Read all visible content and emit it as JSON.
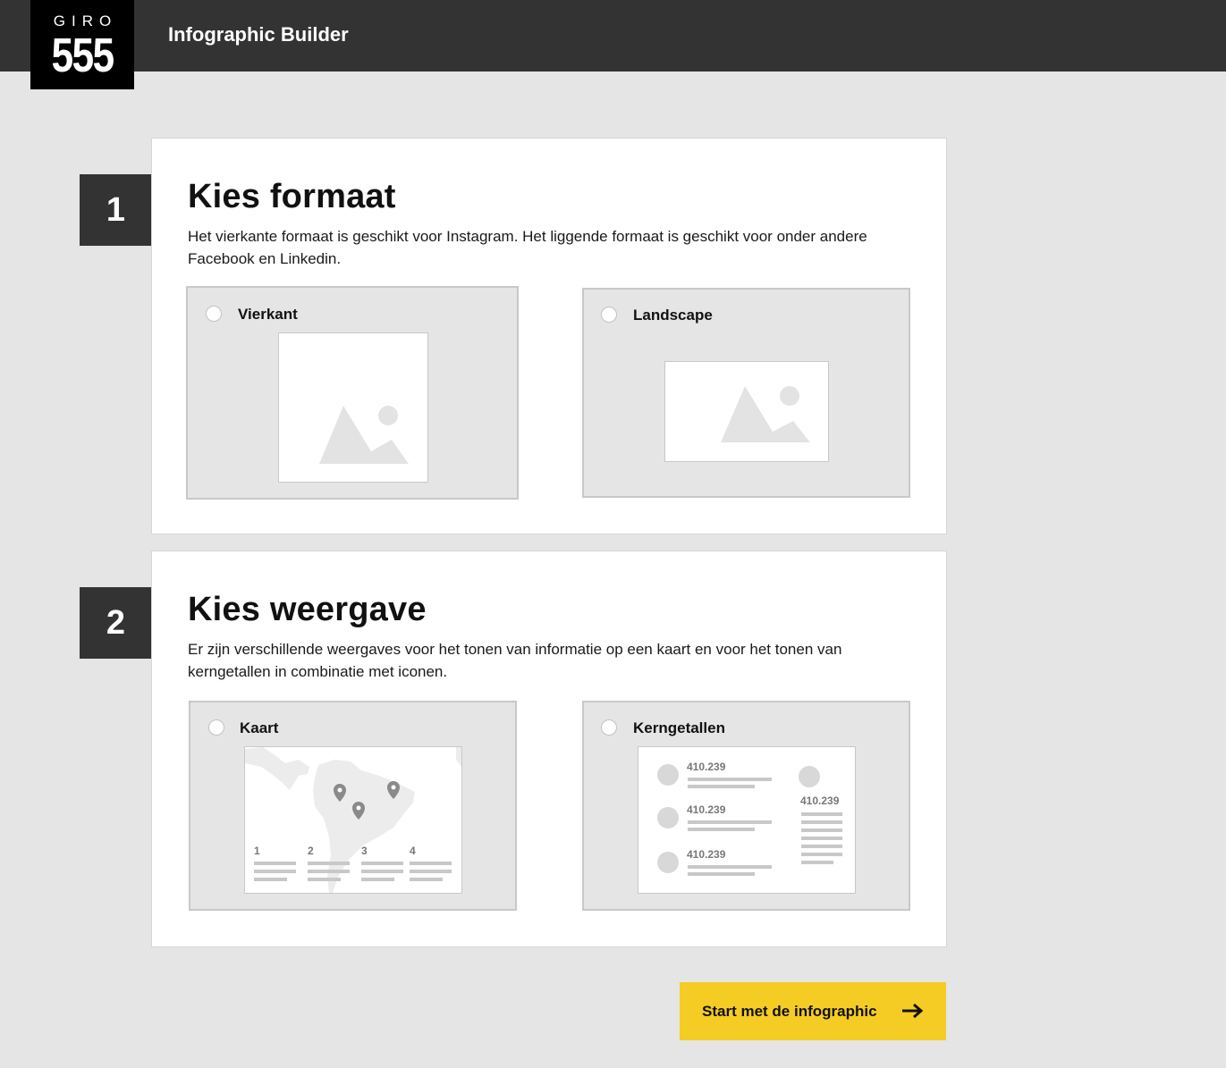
{
  "header": {
    "logo_top": "GIRO",
    "logo_number": "555",
    "title": "Infographic Builder"
  },
  "steps": [
    {
      "number": "1",
      "heading": "Kies formaat",
      "description": "Het vierkante formaat is geschikt voor Instagram. Het liggende formaat is geschikt voor onder andere Facebook en Linkedin.",
      "options": [
        {
          "label": "Vierkant",
          "selected": false,
          "preview_icon": "image-placeholder-icon"
        },
        {
          "label": "Landscape",
          "selected": false,
          "preview_icon": "image-placeholder-icon"
        }
      ]
    },
    {
      "number": "2",
      "heading": "Kies weergave",
      "description": "Er zijn verschillende weergaves voor het tonen van informatie op een kaart en voor het tonen van kerngetallen in combinatie met iconen.",
      "options": [
        {
          "label": "Kaart",
          "selected": false,
          "preview_icon": "map-icon",
          "legend_numbers": [
            "1",
            "2",
            "3",
            "4"
          ]
        },
        {
          "label": "Kerngetallen",
          "selected": false,
          "preview_icon": "key-figures-icon",
          "figures": [
            "410.239",
            "410.239",
            "410.239",
            "410.239"
          ]
        }
      ]
    }
  ],
  "cta": {
    "label": "Start met de infographic",
    "icon": "arrow-right-icon"
  },
  "colors": {
    "header_bg": "#333333",
    "accent": "#f5cc23",
    "page_bg": "#e5e5e5"
  }
}
